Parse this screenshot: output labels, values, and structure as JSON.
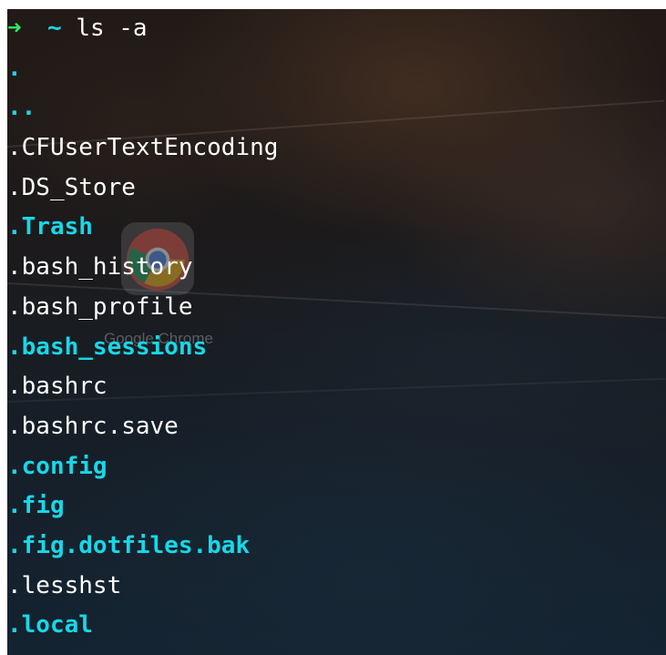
{
  "terminal": {
    "prompt": {
      "arrow": "➜",
      "cwd": "~",
      "command": "ls -a"
    },
    "entries": [
      {
        "name": ".",
        "is_dir": true
      },
      {
        "name": "..",
        "is_dir": true
      },
      {
        "name": ".CFUserTextEncoding",
        "is_dir": false
      },
      {
        "name": ".DS_Store",
        "is_dir": false
      },
      {
        "name": ".Trash",
        "is_dir": true
      },
      {
        "name": ".bash_history",
        "is_dir": false
      },
      {
        "name": ".bash_profile",
        "is_dir": false
      },
      {
        "name": ".bash_sessions",
        "is_dir": true
      },
      {
        "name": ".bashrc",
        "is_dir": false
      },
      {
        "name": ".bashrc.save",
        "is_dir": false
      },
      {
        "name": ".config",
        "is_dir": true
      },
      {
        "name": ".fig",
        "is_dir": true
      },
      {
        "name": ".fig.dotfiles.bak",
        "is_dir": true
      },
      {
        "name": ".lesshst",
        "is_dir": false
      },
      {
        "name": ".local",
        "is_dir": true
      }
    ],
    "colors": {
      "directory": "#16d8e8",
      "file": "#ffffff",
      "prompt_arrow": "#2ee862"
    }
  },
  "desktop": {
    "app_icon": {
      "label": "Google Chrome",
      "icon": "chrome-icon"
    }
  }
}
